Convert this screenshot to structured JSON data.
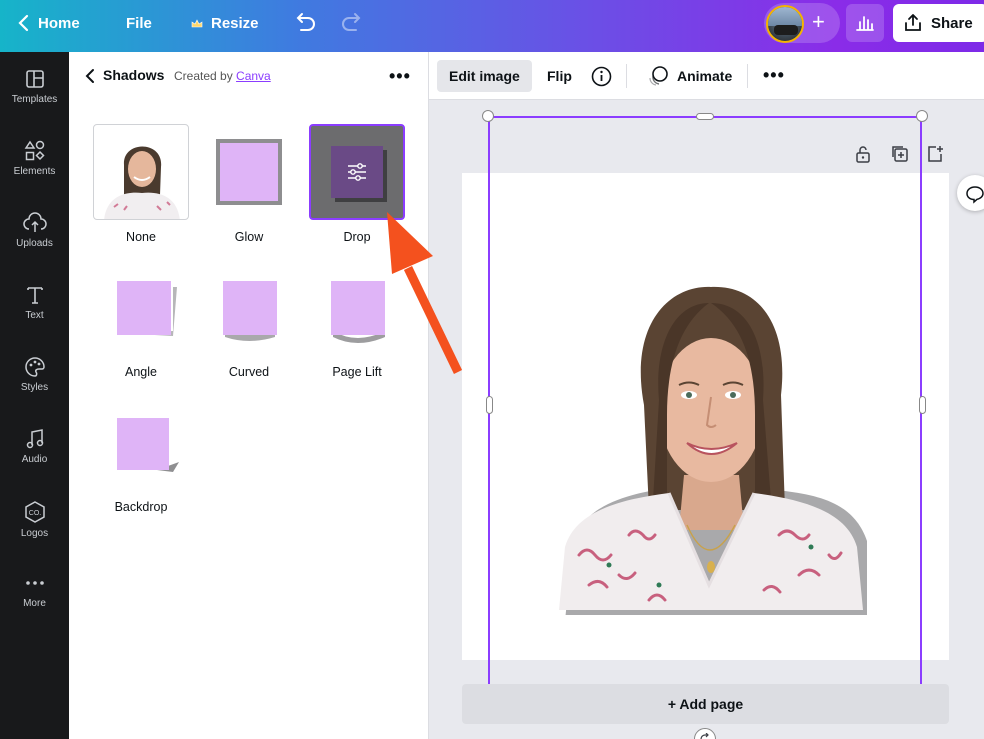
{
  "topbar": {
    "home_label": "Home",
    "file_label": "File",
    "resize_label": "Resize",
    "share_label": "Share"
  },
  "sidebar": {
    "items": [
      {
        "label": "Templates",
        "icon": "templates-icon"
      },
      {
        "label": "Elements",
        "icon": "elements-icon"
      },
      {
        "label": "Uploads",
        "icon": "uploads-icon"
      },
      {
        "label": "Text",
        "icon": "text-icon"
      },
      {
        "label": "Styles",
        "icon": "styles-icon"
      },
      {
        "label": "Audio",
        "icon": "audio-icon"
      },
      {
        "label": "Logos",
        "icon": "logos-icon"
      },
      {
        "label": "More",
        "icon": "more-icon"
      }
    ]
  },
  "panel": {
    "title": "Shadows",
    "created_by": "Created by",
    "creator": "Canva",
    "effects": [
      {
        "label": "None",
        "selected": false
      },
      {
        "label": "Glow",
        "selected": false
      },
      {
        "label": "Drop",
        "selected": true
      },
      {
        "label": "Angle",
        "selected": false
      },
      {
        "label": "Curved",
        "selected": false
      },
      {
        "label": "Page Lift",
        "selected": false
      },
      {
        "label": "Backdrop",
        "selected": false
      }
    ]
  },
  "toolbar": {
    "edit_image": "Edit image",
    "flip": "Flip",
    "animate": "Animate"
  },
  "canvas": {
    "add_page": "+ Add page"
  },
  "colors": {
    "accent": "#8b3dff",
    "swatch": "#dfb4f7",
    "arrow": "#f4511e",
    "sidebar_bg": "#18191b"
  }
}
